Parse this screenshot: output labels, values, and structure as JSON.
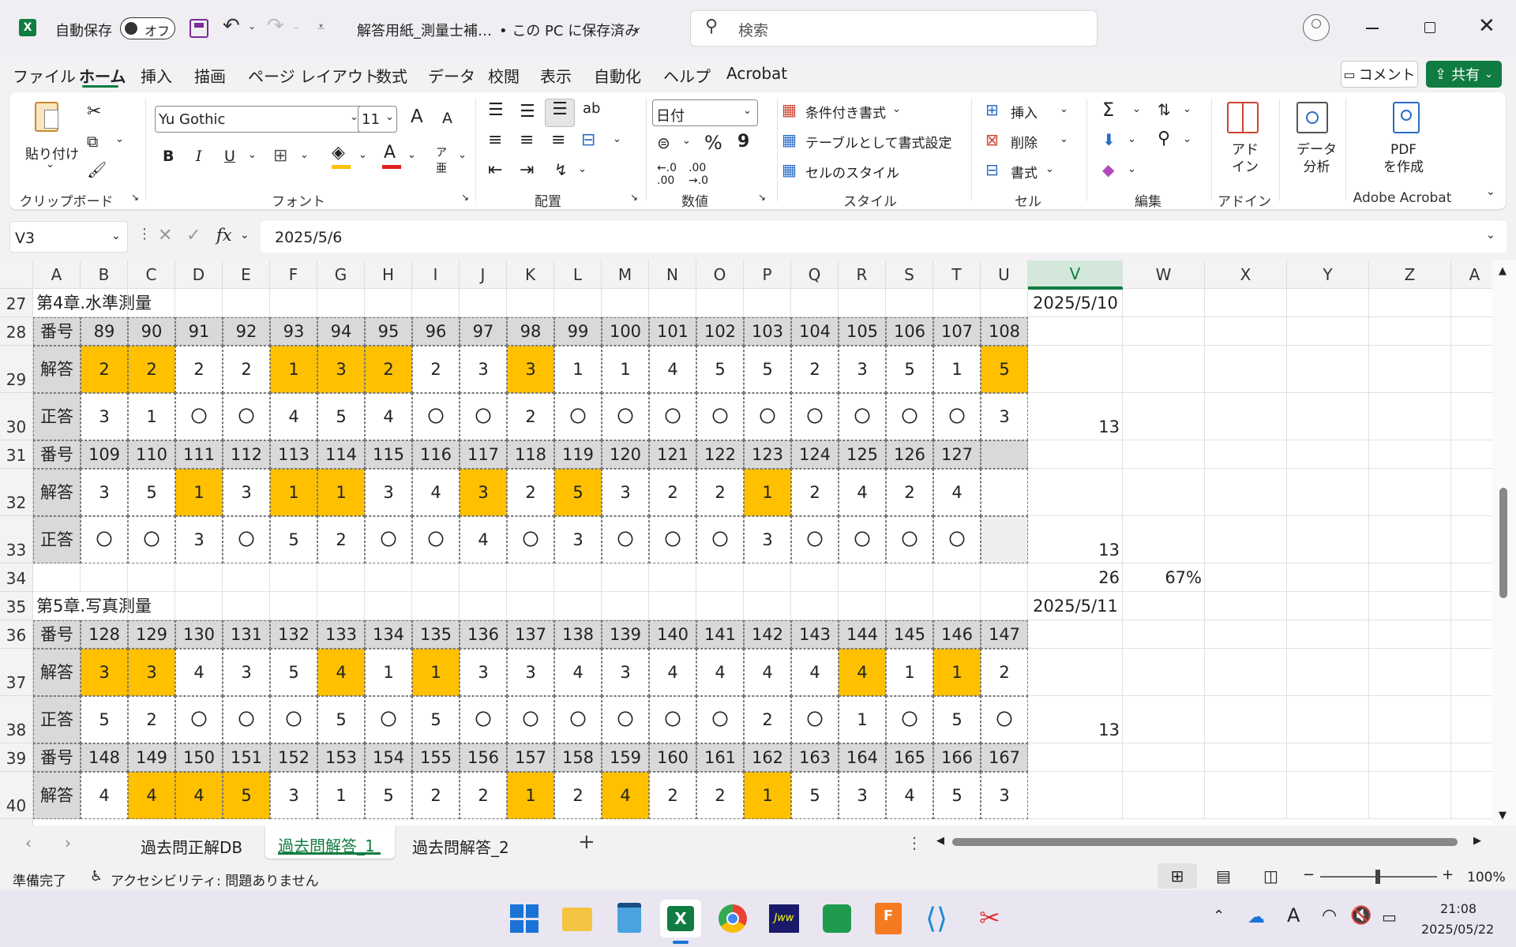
{
  "title_bar": {
    "app_icon": "excel-icon",
    "autosave_label": "自動保存",
    "autosave_state": "オフ",
    "filename": "解答用紙_測量士補…",
    "save_status": "• この PC に保存済み",
    "search_placeholder": "検索"
  },
  "menu": [
    "ファイル",
    "ホーム",
    "挿入",
    "描画",
    "ページ レイアウト",
    "数式",
    "データ",
    "校閲",
    "表示",
    "自動化",
    "ヘルプ",
    "Acrobat"
  ],
  "menu_active": "ホーム",
  "comment_button": "コメント",
  "share_button": "共有",
  "ribbon": {
    "clipboard": {
      "paste": "貼り付け",
      "label": "クリップボード"
    },
    "font": {
      "name": "Yu Gothic",
      "size": "11",
      "label": "フォント",
      "bold": "B",
      "italic": "I",
      "underline": "U",
      "grow": "A",
      "shrink": "A"
    },
    "alignment": {
      "label": "配置"
    },
    "number": {
      "format": "日付",
      "percent": "%",
      "label": "数値"
    },
    "style": {
      "conditional": "条件付き書式",
      "table": "テーブルとして書式設定",
      "cell_style": "セルのスタイル",
      "label": "スタイル"
    },
    "cells": {
      "insert": "挿入",
      "delete": "削除",
      "format": "書式",
      "label": "セル"
    },
    "edit": {
      "label": "編集"
    },
    "addin": {
      "btn": "アド\nイン",
      "label": "アドイン"
    },
    "analysis": {
      "btn": "データ\n分析"
    },
    "acrobat": {
      "btn": "PDF\nを作成",
      "label": "Adobe Acrobat"
    }
  },
  "formula_bar": {
    "name_box": "V3",
    "fx": "fx",
    "value": "2025/5/6"
  },
  "columns": [
    "A",
    "B",
    "C",
    "D",
    "E",
    "F",
    "G",
    "H",
    "I",
    "J",
    "K",
    "L",
    "M",
    "N",
    "O",
    "P",
    "Q",
    "R",
    "S",
    "T",
    "U",
    "V",
    "W",
    "X",
    "Y",
    "Z",
    "A"
  ],
  "selected_column": "V",
  "rows": [
    {
      "num": "27",
      "type": "title",
      "text": "第4章.水準測量",
      "v": "2025/5/10"
    },
    {
      "num": "28",
      "type": "num",
      "label": "番号",
      "cells": [
        "89",
        "90",
        "91",
        "92",
        "93",
        "94",
        "95",
        "96",
        "97",
        "98",
        "99",
        "100",
        "101",
        "102",
        "103",
        "104",
        "105",
        "106",
        "107",
        "108"
      ]
    },
    {
      "num": "29",
      "type": "ans",
      "label": "解答",
      "cells": [
        "2",
        "2",
        "2",
        "2",
        "1",
        "3",
        "2",
        "2",
        "3",
        "3",
        "1",
        "1",
        "4",
        "5",
        "5",
        "2",
        "3",
        "5",
        "1",
        "5"
      ],
      "hl": [
        0,
        1,
        4,
        5,
        6,
        9,
        19
      ]
    },
    {
      "num": "30",
      "type": "cor",
      "label": "正答",
      "cells": [
        "3",
        "1",
        "〇",
        "〇",
        "4",
        "5",
        "4",
        "〇",
        "〇",
        "2",
        "〇",
        "〇",
        "〇",
        "〇",
        "〇",
        "〇",
        "〇",
        "〇",
        "〇",
        "3"
      ],
      "v": "13"
    },
    {
      "num": "31",
      "type": "num",
      "label": "番号",
      "cells": [
        "109",
        "110",
        "111",
        "112",
        "113",
        "114",
        "115",
        "116",
        "117",
        "118",
        "119",
        "120",
        "121",
        "122",
        "123",
        "124",
        "125",
        "126",
        "127",
        ""
      ]
    },
    {
      "num": "32",
      "type": "ans",
      "label": "解答",
      "cells": [
        "3",
        "5",
        "1",
        "3",
        "1",
        "1",
        "3",
        "4",
        "3",
        "2",
        "5",
        "3",
        "2",
        "2",
        "1",
        "2",
        "4",
        "2",
        "4",
        ""
      ],
      "hl": [
        2,
        4,
        5,
        8,
        10,
        14
      ]
    },
    {
      "num": "33",
      "type": "cor",
      "label": "正答",
      "cells": [
        "〇",
        "〇",
        "3",
        "〇",
        "5",
        "2",
        "〇",
        "〇",
        "4",
        "〇",
        "3",
        "〇",
        "〇",
        "〇",
        "3",
        "〇",
        "〇",
        "〇",
        "〇",
        ""
      ],
      "v": "13"
    },
    {
      "num": "34",
      "type": "sum",
      "v": "26",
      "w": "67%"
    },
    {
      "num": "35",
      "type": "title",
      "text": "第5章.写真測量",
      "v": "2025/5/11"
    },
    {
      "num": "36",
      "type": "num",
      "label": "番号",
      "cells": [
        "128",
        "129",
        "130",
        "131",
        "132",
        "133",
        "134",
        "135",
        "136",
        "137",
        "138",
        "139",
        "140",
        "141",
        "142",
        "143",
        "144",
        "145",
        "146",
        "147"
      ]
    },
    {
      "num": "37",
      "type": "ans",
      "label": "解答",
      "cells": [
        "3",
        "3",
        "4",
        "3",
        "5",
        "4",
        "1",
        "1",
        "3",
        "3",
        "4",
        "3",
        "4",
        "4",
        "4",
        "4",
        "4",
        "1",
        "1",
        "2"
      ],
      "hl": [
        0,
        1,
        5,
        7,
        16,
        18
      ]
    },
    {
      "num": "38",
      "type": "cor",
      "label": "正答",
      "cells": [
        "5",
        "2",
        "〇",
        "〇",
        "〇",
        "5",
        "〇",
        "5",
        "〇",
        "〇",
        "〇",
        "〇",
        "〇",
        "〇",
        "2",
        "〇",
        "1",
        "〇",
        "5",
        "〇"
      ],
      "v": "13"
    },
    {
      "num": "39",
      "type": "num",
      "label": "番号",
      "cells": [
        "148",
        "149",
        "150",
        "151",
        "152",
        "153",
        "154",
        "155",
        "156",
        "157",
        "158",
        "159",
        "160",
        "161",
        "162",
        "163",
        "164",
        "165",
        "166",
        "167"
      ]
    },
    {
      "num": "40",
      "type": "ans",
      "label": "解答",
      "cells": [
        "4",
        "4",
        "4",
        "5",
        "3",
        "1",
        "5",
        "2",
        "2",
        "1",
        "2",
        "4",
        "2",
        "2",
        "1",
        "5",
        "3",
        "4",
        "5",
        "3"
      ],
      "hl": [
        1,
        2,
        3,
        9,
        11,
        14
      ]
    }
  ],
  "sheet_tabs": [
    "過去問正解DB",
    "過去問解答_1",
    "過去問解答_2"
  ],
  "active_tab": "過去問解答_1",
  "status": {
    "ready": "準備完了",
    "accessibility": "アクセシビリティ: 問題ありません",
    "zoom": "100%"
  },
  "taskbar": {
    "time": "21:08",
    "date": "2025/05/22"
  },
  "colors": {
    "highlight": "#FFC000",
    "header_gray": "#D9D9D9",
    "excel_green": "#107C41"
  }
}
